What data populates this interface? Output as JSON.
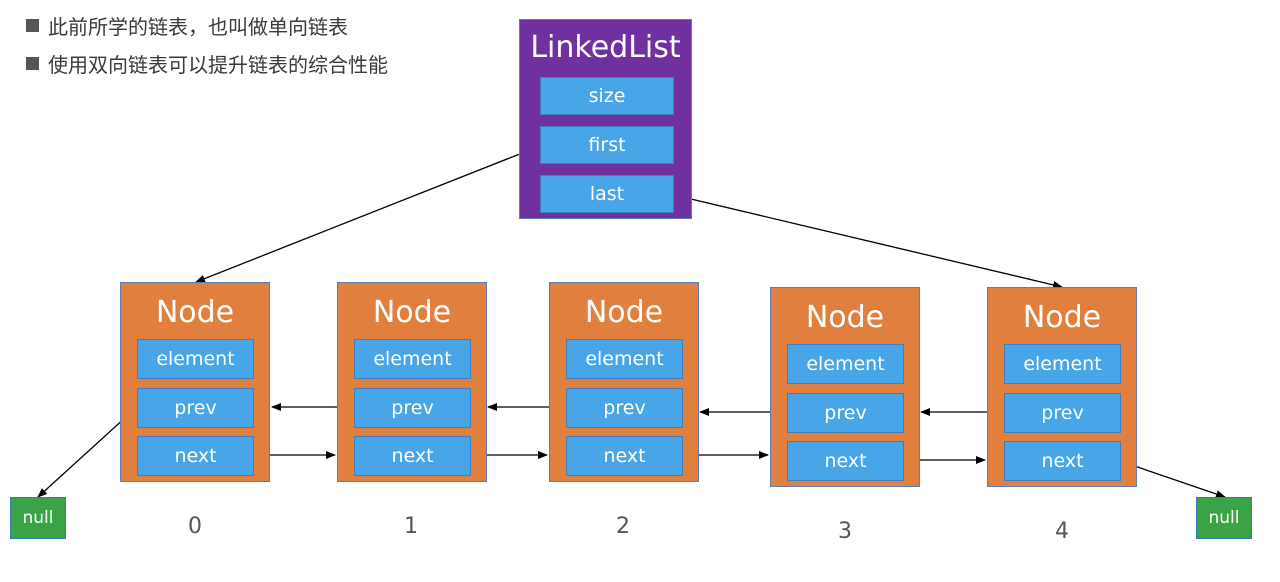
{
  "bullets": [
    "此前所学的链表，也叫做单向链表",
    "使用双向链表可以提升链表的综合性能"
  ],
  "linked_list": {
    "title": "LinkedList",
    "fields": [
      "size",
      "first",
      "last"
    ]
  },
  "nodes": [
    {
      "title": "Node",
      "fields": [
        "element",
        "prev",
        "next"
      ],
      "index": "0"
    },
    {
      "title": "Node",
      "fields": [
        "element",
        "prev",
        "next"
      ],
      "index": "1"
    },
    {
      "title": "Node",
      "fields": [
        "element",
        "prev",
        "next"
      ],
      "index": "2"
    },
    {
      "title": "Node",
      "fields": [
        "element",
        "prev",
        "next"
      ],
      "index": "3"
    },
    {
      "title": "Node",
      "fields": [
        "element",
        "prev",
        "next"
      ],
      "index": "4"
    }
  ],
  "null_left": "null",
  "null_right": "null",
  "colors": {
    "linked_list_bg": "#7030a0",
    "node_bg": "#e17f3e",
    "field_bg": "#47a5e8",
    "null_bg": "#3aa346"
  }
}
